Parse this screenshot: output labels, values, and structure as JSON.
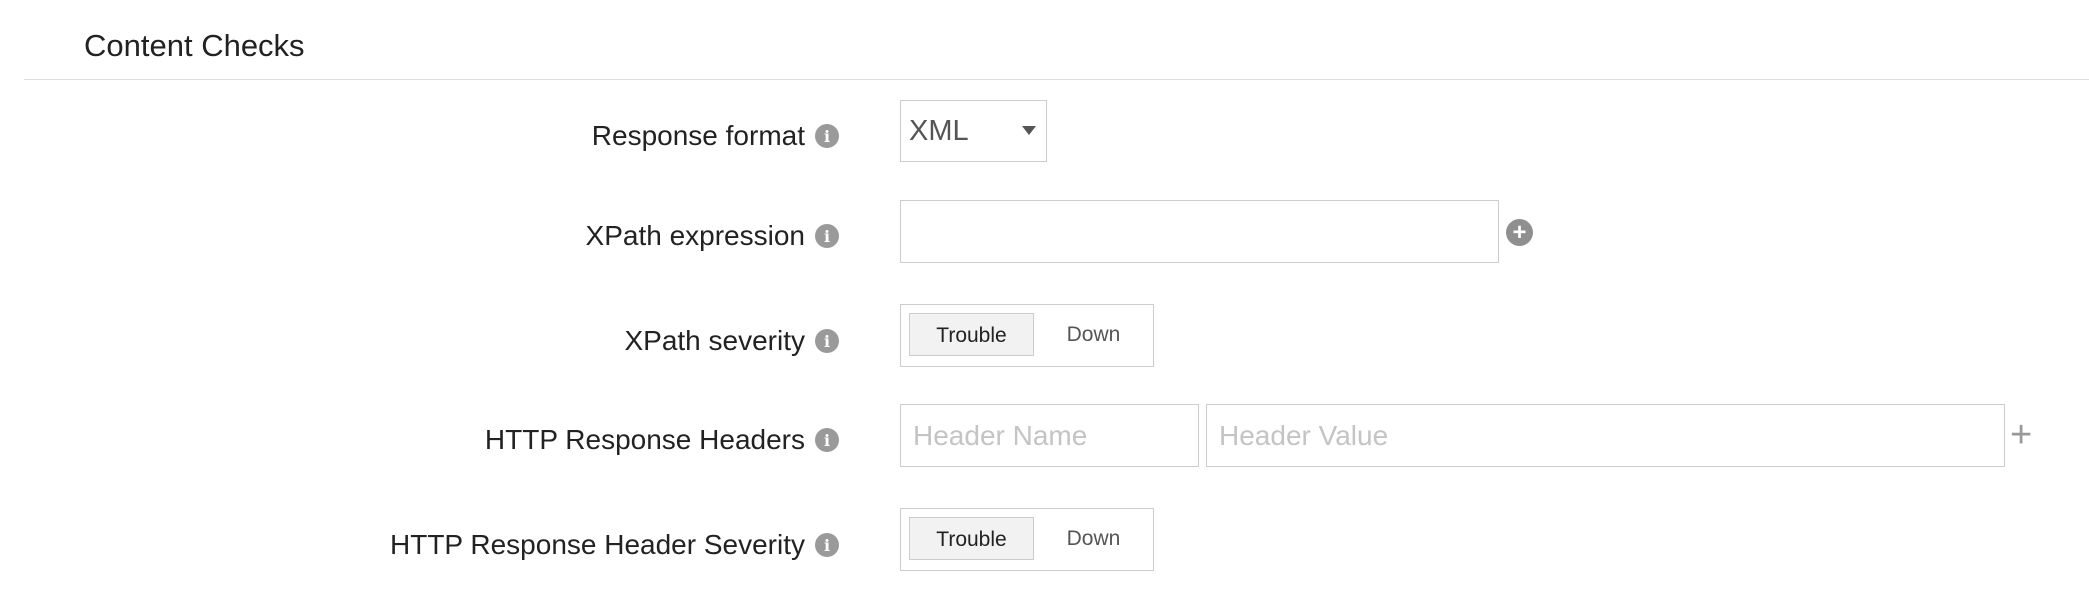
{
  "section": {
    "title": "Content Checks"
  },
  "rows": {
    "response_format": {
      "label": "Response format",
      "value": "XML"
    },
    "xpath_expression": {
      "label": "XPath expression",
      "value": ""
    },
    "xpath_severity": {
      "label": "XPath severity",
      "options": [
        "Trouble",
        "Down"
      ],
      "selected": "Trouble"
    },
    "http_headers": {
      "label": "HTTP Response Headers",
      "name_placeholder": "Header Name",
      "value_placeholder": "Header Value"
    },
    "http_header_severity": {
      "label": "HTTP Response Header Severity",
      "options": [
        "Trouble",
        "Down"
      ],
      "selected": "Trouble"
    }
  },
  "icons": {
    "info": "info-icon",
    "add_circle": "plus-circle-icon",
    "add": "plus-icon"
  },
  "colors": {
    "icon_gray": "#9a9a9a",
    "border": "#cccccc",
    "placeholder": "#c4c4c4"
  }
}
